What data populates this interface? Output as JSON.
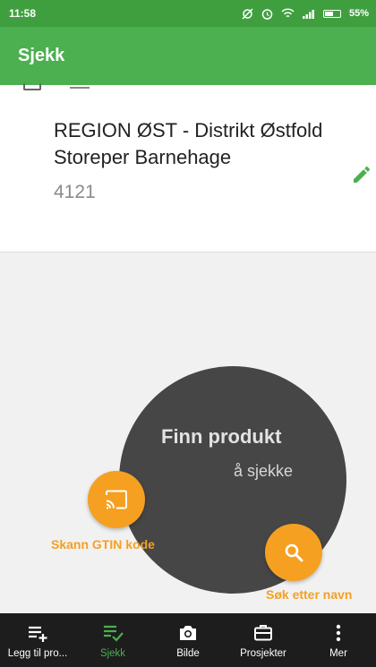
{
  "status_bar": {
    "time": "11:58",
    "battery": "55%"
  },
  "app_bar": {
    "title": "Sjekk"
  },
  "project": {
    "name": "REGION ØST - Distrikt Østfold Storeper Barnehage",
    "code": "4121"
  },
  "finder": {
    "title": "Finn produkt",
    "subtitle": "å sjekke",
    "scan_label": "Skann GTIN kode",
    "search_label": "Søk etter navn"
  },
  "nav": {
    "items": [
      {
        "label": "Legg til pro...",
        "icon": "playlist-add-icon"
      },
      {
        "label": "Sjekk",
        "icon": "playlist-check-icon",
        "active": true
      },
      {
        "label": "Bilde",
        "icon": "camera-icon"
      },
      {
        "label": "Prosjekter",
        "icon": "briefcase-icon"
      },
      {
        "label": "Mer",
        "icon": "more-vert-icon"
      }
    ]
  },
  "colors": {
    "primary": "#4caf50",
    "status": "#3f9f3f",
    "accent": "#f5a021",
    "circle": "#464646",
    "nav": "#1d1d1d"
  }
}
